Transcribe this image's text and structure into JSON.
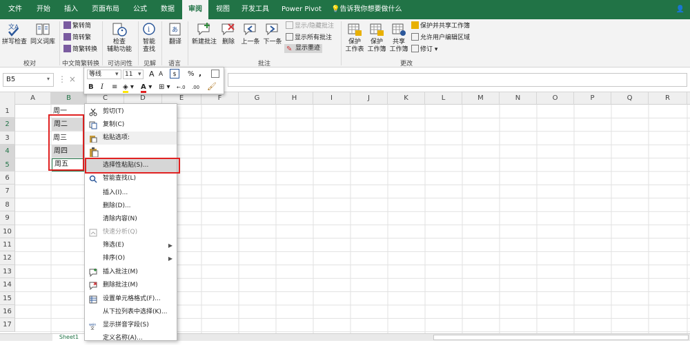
{
  "ribbon_tabs": [
    "文件",
    "开始",
    "插入",
    "页面布局",
    "公式",
    "数据",
    "审阅",
    "视图",
    "开发工具",
    "Power Pivot"
  ],
  "tell_me": "告诉我你想要做什么",
  "active_tab": "审阅",
  "ribbon": {
    "spell_check": "拼写检查",
    "thesaurus": "同义词库",
    "group_proofing": "校对",
    "trad_to_simp": "繁转简",
    "simp_to_trad": "简转繁",
    "conversion": "简繁转换",
    "group_chinese": "中文简繁转换",
    "check_access_1": "检查",
    "check_access_2": "辅助功能",
    "group_access": "可访问性",
    "smart_lookup_1": "智能",
    "smart_lookup_2": "查找",
    "group_insights": "见解",
    "translate": "翻译",
    "group_language": "语言",
    "new_comment": "新建批注",
    "delete": "删除",
    "previous": "上一条",
    "next": "下一条",
    "show_hide_comment": "显示/隐藏批注",
    "show_all_comments": "显示所有批注",
    "show_ink": "显示墨迹",
    "group_comments": "批注",
    "protect_sheet_1": "保护",
    "protect_sheet_2": "工作表",
    "protect_wb_1": "保护",
    "protect_wb_2": "工作簿",
    "share_wb_1": "共享",
    "share_wb_2": "工作簿",
    "protect_share": "保护并共享工作簿",
    "allow_edit": "允许用户编辑区域",
    "track_changes": "修订",
    "group_changes": "更改"
  },
  "name_box": "B5",
  "columns": [
    "A",
    "B",
    "C",
    "D",
    "E",
    "F",
    "G",
    "H",
    "I",
    "J",
    "K",
    "L",
    "M",
    "N",
    "O",
    "P",
    "Q",
    "R"
  ],
  "rows": [
    "1",
    "2",
    "3",
    "4",
    "5",
    "6",
    "7",
    "8",
    "9",
    "10",
    "11",
    "12",
    "13",
    "14",
    "15",
    "16",
    "17"
  ],
  "cells": [
    "周一",
    "周二",
    "周三",
    "周四",
    "周五"
  ],
  "mini_toolbar": {
    "font": "等线",
    "size": "11",
    "grow": "A",
    "shrink": "A",
    "percent": "%",
    "comma": ",",
    "bold": "B",
    "italic": "I",
    "dec_inc": "←.0",
    "dec_dec": ".00"
  },
  "context_menu": [
    {
      "label": "剪切(T)",
      "icon": "scissors-icon",
      "disabled": false
    },
    {
      "label": "复制(C)",
      "icon": "copy-icon",
      "disabled": false
    },
    {
      "label": "粘贴选项:",
      "icon": "paste-icon",
      "disabled": false,
      "bold": true
    },
    {
      "label": "",
      "icon": "clipboard-icon",
      "disabled": false
    },
    {
      "label": "选择性粘贴(S)...",
      "icon": "",
      "disabled": false,
      "highlight": true
    },
    {
      "label": "智能查找(L)",
      "icon": "search-icon",
      "disabled": false
    },
    {
      "label": "插入(I)...",
      "icon": "",
      "disabled": false
    },
    {
      "label": "删除(D)...",
      "icon": "",
      "disabled": false
    },
    {
      "label": "清除内容(N)",
      "icon": "",
      "disabled": false
    },
    {
      "label": "快速分析(Q)",
      "icon": "quick-analysis-icon",
      "disabled": true
    },
    {
      "label": "筛选(E)",
      "icon": "",
      "disabled": false,
      "submenu": true
    },
    {
      "label": "排序(O)",
      "icon": "",
      "disabled": false,
      "submenu": true
    },
    {
      "label": "插入批注(M)",
      "icon": "comment-icon",
      "disabled": false
    },
    {
      "label": "删除批注(M)",
      "icon": "delete-comment-icon",
      "disabled": false
    },
    {
      "label": "设置单元格格式(F)...",
      "icon": "format-cells-icon",
      "disabled": false
    },
    {
      "label": "从下拉列表中选择(K)...",
      "icon": "",
      "disabled": false
    },
    {
      "label": "显示拼音字段(S)",
      "icon": "phonetic-icon",
      "disabled": false
    },
    {
      "label": "定义名称(A)...",
      "icon": "",
      "disabled": false
    }
  ],
  "sheet_tab": "Sheet1",
  "colors": {
    "brand": "#217346",
    "highlight_box": "#e02020"
  }
}
